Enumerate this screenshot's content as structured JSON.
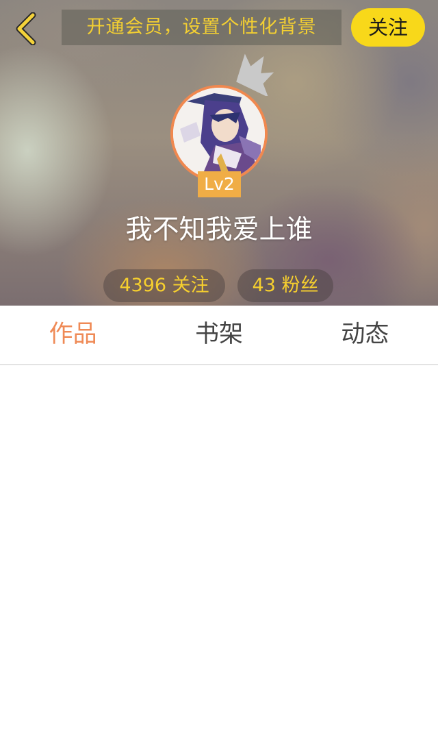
{
  "header": {
    "back_icon": "chevron-left-icon",
    "vip_banner": "开通会员，设置个性化背景",
    "follow_button": "关注"
  },
  "profile": {
    "crown_icon": "crown-icon",
    "avatar": "user-avatar",
    "level": "Lv2",
    "nickname": "我不知我爱上谁",
    "following_stat": "4396 关注",
    "fans_stat": "43 粉丝"
  },
  "tabs": [
    {
      "label": "作品",
      "active": true
    },
    {
      "label": "书架",
      "active": false
    },
    {
      "label": "动态",
      "active": false
    }
  ],
  "colors": {
    "accent_orange": "#ef8a56",
    "badge_orange": "#f0ad46",
    "follow_yellow": "#f8d81a",
    "stat_text_yellow": "#f6cf2e"
  }
}
